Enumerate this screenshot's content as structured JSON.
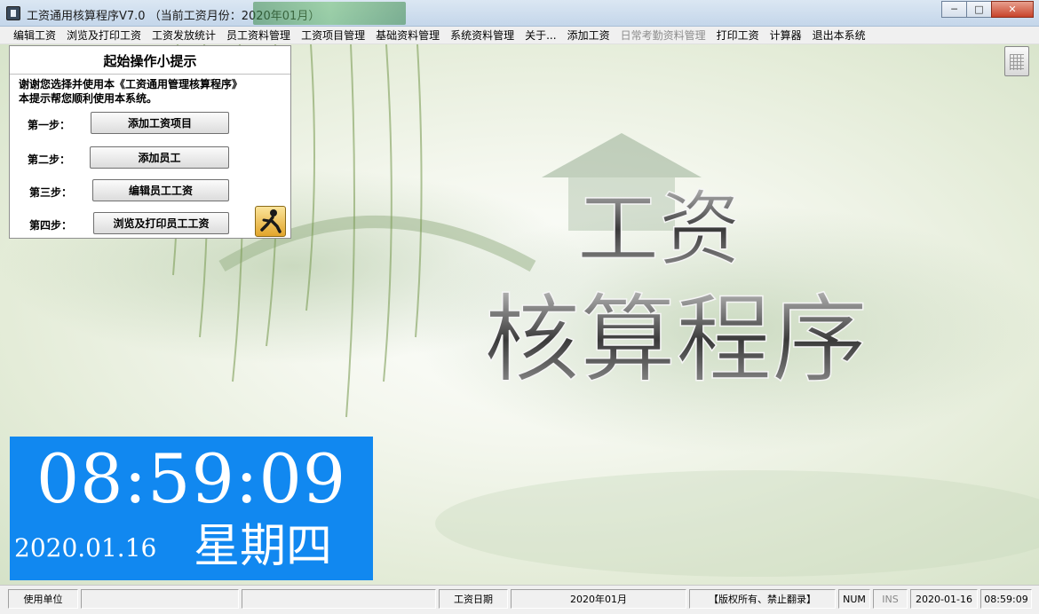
{
  "titlebar": {
    "title": "工资通用核算程序V7.0 （当前工资月份：2020年01月）",
    "minimize_glyph": "─",
    "maximize_glyph": "□",
    "close_glyph": "✕"
  },
  "menu": [
    {
      "label": "编辑工资",
      "enabled": true
    },
    {
      "label": "浏览及打印工资",
      "enabled": true
    },
    {
      "label": "工资发放统计",
      "enabled": true
    },
    {
      "label": "员工资料管理",
      "enabled": true
    },
    {
      "label": "工资项目管理",
      "enabled": true
    },
    {
      "label": "基础资料管理",
      "enabled": true
    },
    {
      "label": "系统资料管理",
      "enabled": true
    },
    {
      "label": "关于...",
      "enabled": true
    },
    {
      "label": "添加工资",
      "enabled": true
    },
    {
      "label": "日常考勤资料管理",
      "enabled": false
    },
    {
      "label": "打印工资",
      "enabled": true
    },
    {
      "label": "计算器",
      "enabled": true
    },
    {
      "label": "退出本系统",
      "enabled": true
    }
  ],
  "tips": {
    "title": "起始操作小提示",
    "desc_line1": "谢谢您选择并使用本《工资通用管理核算程序》",
    "desc_line2": "本提示帮您顺利使用本系统。",
    "steps": [
      {
        "label": "第一步：",
        "button": "添加工资项目"
      },
      {
        "label": "第二步：",
        "button": "添加员工"
      },
      {
        "label": "第三步：",
        "button": "编辑员工工资"
      },
      {
        "label": "第四步：",
        "button": "浏览及打印员工工资"
      }
    ]
  },
  "background": {
    "line1": "工资",
    "line2": "核算程序"
  },
  "clock": {
    "time": "08:59:09",
    "date": "2020.01.16",
    "weekday": "星期四"
  },
  "statusbar": {
    "unit_label": "使用单位",
    "unit_value": "",
    "blank": "",
    "date_label": "工资日期",
    "date_value": "2020年01月",
    "copyright": "【版权所有、禁止翻录】",
    "num": "NUM",
    "ins": "INS",
    "sys_date": "2020-01-16",
    "sys_time": "08:59:09"
  },
  "colors": {
    "clock_bg": "#1188f0",
    "title_accent": "#3b8a4a"
  }
}
